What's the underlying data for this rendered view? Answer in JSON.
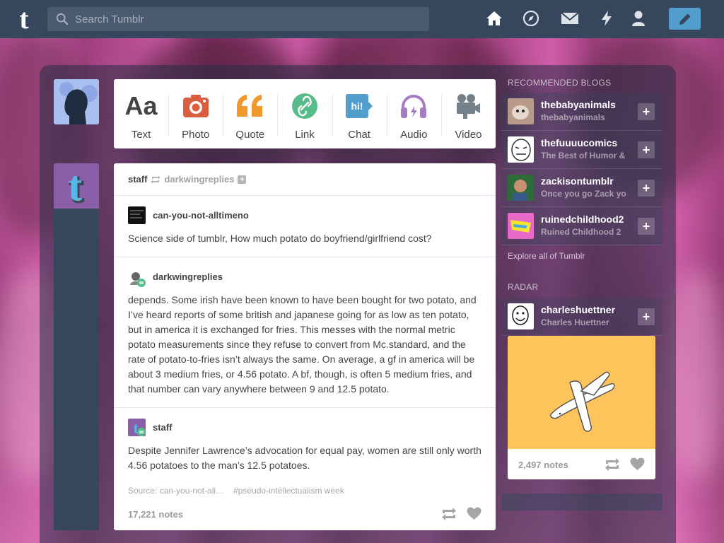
{
  "app": {
    "logo": "t",
    "search_placeholder": "Search Tumblr",
    "brand_color": "#36465d",
    "accent_color": "#529ecc"
  },
  "nav": {
    "icons": [
      "home-icon",
      "explore-icon",
      "messages-icon",
      "activity-icon",
      "account-icon",
      "compose-icon"
    ]
  },
  "post_types": [
    {
      "label": "Text",
      "icon": "text-icon",
      "glyph": "Aa",
      "color": "#444444"
    },
    {
      "label": "Photo",
      "icon": "camera-icon",
      "color": "#d95e40"
    },
    {
      "label": "Quote",
      "icon": "quote-icon",
      "glyph": "““",
      "color": "#f2992e"
    },
    {
      "label": "Link",
      "icon": "link-icon",
      "color": "#56bc8a"
    },
    {
      "label": "Chat",
      "icon": "chat-icon",
      "glyph": "hi!",
      "color": "#529ecc"
    },
    {
      "label": "Audio",
      "icon": "headphones-icon",
      "color": "#a77dc2"
    },
    {
      "label": "Video",
      "icon": "video-camera-icon",
      "color": "#748089"
    }
  ],
  "post": {
    "author": "staff",
    "reblogged_from": "darkwingreplies",
    "follow_glyph": "+",
    "entries": [
      {
        "name": "can-you-not-alltimeno",
        "text": "Science side of tumblr, How much potato do boyfriend/girlfriend cost?"
      },
      {
        "name": "darkwingreplies",
        "text": "depends. Some irish have been known to have been bought for two potato, and I’ve heard reports of some british and japanese going for as low as ten potato, but in america it is exchanged for fries. This messes with the normal metric potato measurements since they refuse to convert from Mc.standard, and the rate of potato-to-fries isn’t always the same. On average, a gf in america will be about 3 medium fries, or 4.56 potato. A bf, though, is often 5 medium fries, and that number can vary anywhere between 9 and 12.5 potato."
      },
      {
        "name": "staff",
        "text": "Despite Jennifer Lawrence’s advocation for equal pay, women are still only worth 4.56 potatoes to the man’s 12.5 potatoes."
      }
    ],
    "source": "Source: can-you-not-all…",
    "tag": "#pseudo-intellectualism week",
    "notes": "17,221 notes"
  },
  "sidebar": {
    "recommended_title": "RECOMMENDED BLOGS",
    "blogs": [
      {
        "name": "thebabyanimals",
        "sub": "thebabyanimals",
        "follow": "+"
      },
      {
        "name": "thefuuuucomics",
        "sub": "The Best of Humor & ",
        "follow": "+"
      },
      {
        "name": "zackisontumblr",
        "sub": "Once you go Zack yo",
        "follow": "+"
      },
      {
        "name": "ruinedchildhood2",
        "sub": "Ruined Childhood 2",
        "follow": "+"
      }
    ],
    "explore": "Explore all of Tumblr",
    "radar_title": "RADAR",
    "radar": {
      "name": "charleshuettner",
      "sub": "Charles Huettner",
      "follow": "+",
      "notes": "2,497 notes"
    }
  }
}
